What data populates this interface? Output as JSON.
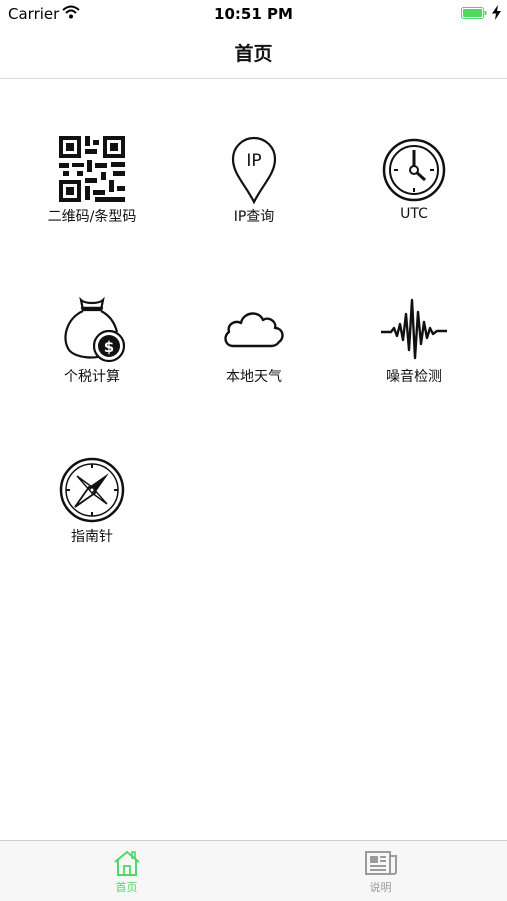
{
  "status_bar": {
    "carrier": "Carrier",
    "time": "10:51 PM",
    "battery_color": "#4cd964"
  },
  "nav": {
    "title": "首页"
  },
  "grid": {
    "items": [
      {
        "label": "二维码/条型码",
        "icon": "qr-code-icon"
      },
      {
        "label": "IP查询",
        "icon": "location-pin-ip-icon"
      },
      {
        "label": "UTC",
        "icon": "clock-icon"
      },
      {
        "label": "个税计算",
        "icon": "money-bag-icon"
      },
      {
        "label": "本地天气",
        "icon": "cloud-icon"
      },
      {
        "label": "噪音检测",
        "icon": "sound-wave-icon"
      },
      {
        "label": "指南针",
        "icon": "compass-icon"
      }
    ],
    "ip_icon_text": "IP"
  },
  "tab_bar": {
    "active_color": "#4cd964",
    "inactive_color": "#9b9b9b",
    "tabs": [
      {
        "label": "首页",
        "icon": "home-icon",
        "active": true
      },
      {
        "label": "说明",
        "icon": "newspaper-icon",
        "active": false
      }
    ]
  }
}
